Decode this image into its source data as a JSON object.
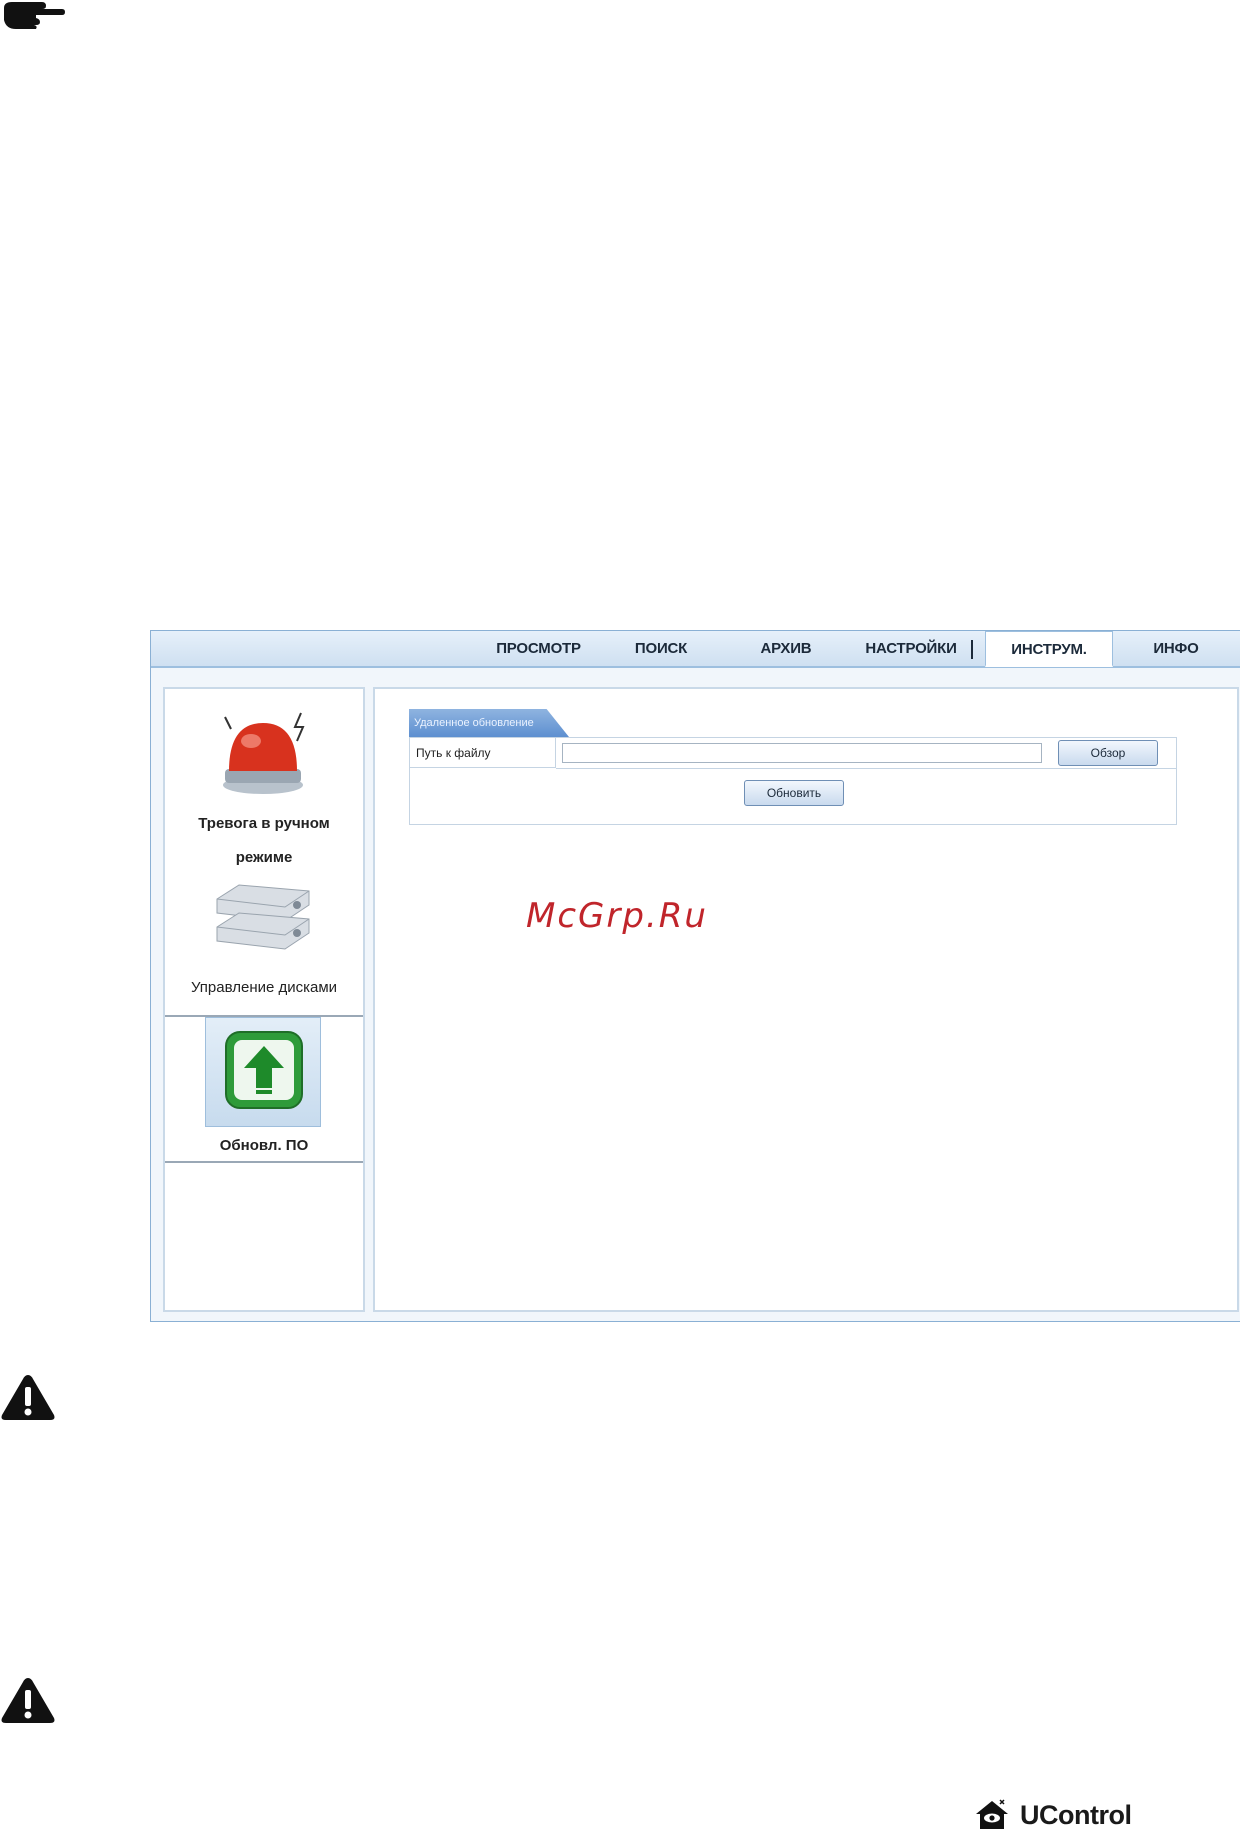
{
  "icons": {
    "hand": "pointing-hand-icon",
    "warning": "warning-triangle-icon",
    "alarm": "alarm-siren-icon",
    "disks": "hard-disks-icon",
    "update": "upload-arrow-icon",
    "brand": "house-eye-icon"
  },
  "nav": {
    "tabs": [
      {
        "label": "ПРОСМОТР"
      },
      {
        "label": "ПОИСК"
      },
      {
        "label": "АРХИВ"
      },
      {
        "label": "НАСТРОЙКИ"
      },
      {
        "label": "ИНСТРУМ."
      },
      {
        "label": "ИНФО"
      }
    ],
    "active_tab": "ИНСТРУМ."
  },
  "sidebar": {
    "items": [
      {
        "label_line1": "Тревога в ручном",
        "label_line2": "режиме"
      },
      {
        "label": "Управление дисками"
      },
      {
        "label": "Обновл. ПО"
      }
    ],
    "selected": "Обновл. ПО"
  },
  "panel": {
    "tab_label": "Удаленное обновление",
    "path_label": "Путь к файлу",
    "path_value": "",
    "browse_button": "Обзор",
    "update_button": "Обновить"
  },
  "watermark": "McGrp.Ru",
  "brand": {
    "name": "UControl"
  },
  "colors": {
    "accent_blue": "#5d8fd0",
    "frame_border": "#8ab0d4",
    "alarm_red": "#d8321e",
    "update_green": "#2e9b3a",
    "watermark_red": "#c0252b"
  }
}
